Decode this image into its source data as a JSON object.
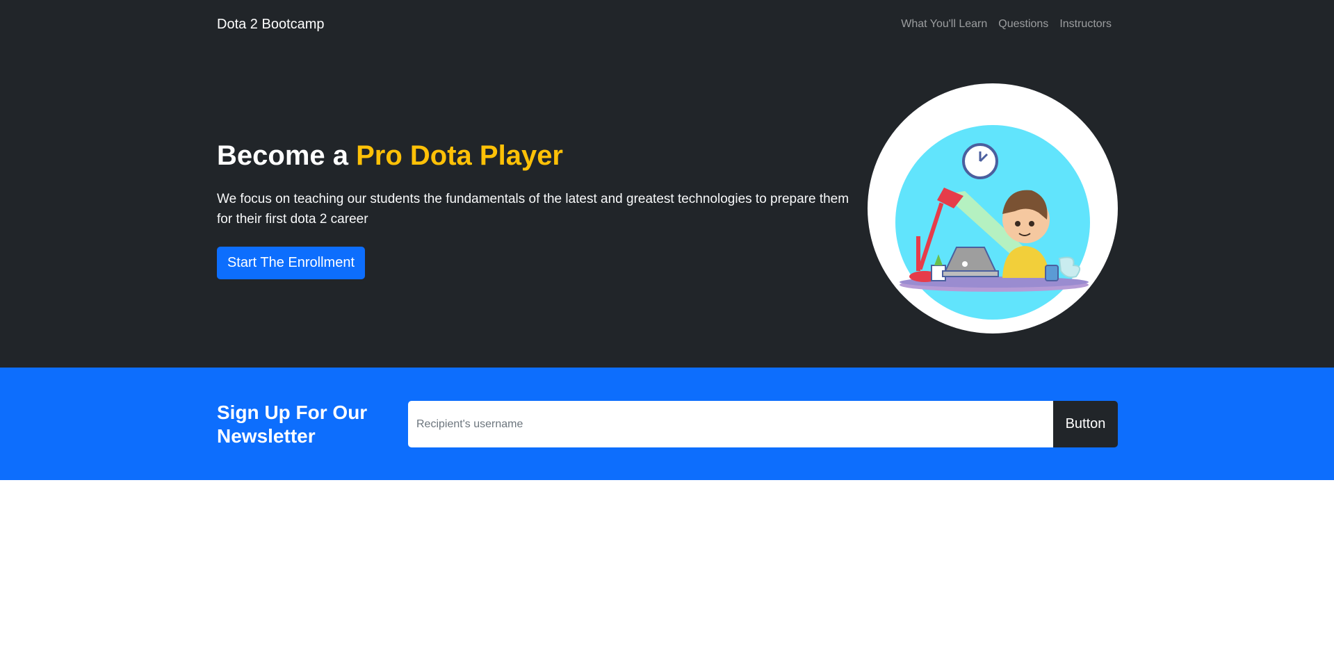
{
  "navbar": {
    "brand": "Dota 2 Bootcamp",
    "links": [
      {
        "label": "What You'll Learn"
      },
      {
        "label": "Questions"
      },
      {
        "label": "Instructors"
      }
    ]
  },
  "hero": {
    "title_prefix": "Become a ",
    "title_accent": "Pro Dota Player",
    "lead": "We focus on teaching our students the fundamentals of the latest and greatest technologies to prepare them for their first dota 2 career",
    "button_label": "Start The Enrollment",
    "image_icon": "person-at-laptop-illustration"
  },
  "newsletter": {
    "title": "Sign Up For Our Newsletter",
    "input_placeholder": "Recipient's username",
    "input_value": "",
    "button_label": "Button"
  },
  "colors": {
    "dark": "#212529",
    "primary": "#0d6efd",
    "accent": "#ffc107"
  }
}
